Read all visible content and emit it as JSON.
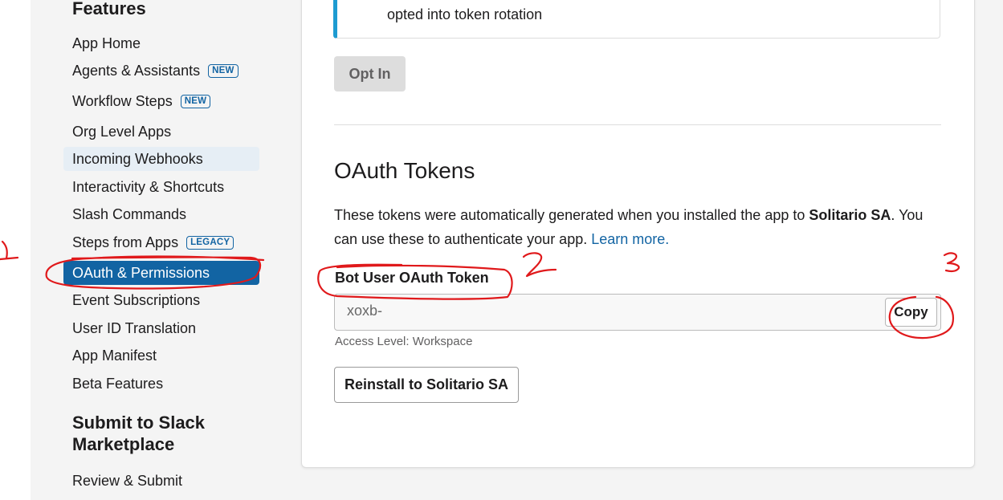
{
  "sidebar": {
    "features_title": "Features",
    "items": [
      {
        "label": "App Home"
      },
      {
        "label": "Agents & Assistants",
        "badge": "NEW"
      },
      {
        "label": "Workflow Steps",
        "badge": "NEW"
      },
      {
        "label": "Org Level Apps"
      },
      {
        "label": "Incoming Webhooks"
      },
      {
        "label": "Interactivity & Shortcuts"
      },
      {
        "label": "Slash Commands"
      },
      {
        "label": "Steps from Apps",
        "badge": "LEGACY"
      },
      {
        "label": "OAuth & Permissions"
      },
      {
        "label": "Event Subscriptions"
      },
      {
        "label": "User ID Translation"
      },
      {
        "label": "App Manifest"
      },
      {
        "label": "Beta Features"
      }
    ],
    "submit_title_line1": "Submit to Slack",
    "submit_title_line2": "Marketplace",
    "submit_item": "Review & Submit"
  },
  "main": {
    "notice_text": "opted into token rotation",
    "opt_in_button": "Opt In",
    "oauth_heading": "OAuth Tokens",
    "description_part1": "These tokens were automatically generated when you installed the app to ",
    "description_workspace": "Solitario SA",
    "description_part2": ". You can use these to authenticate your app. ",
    "learn_more": "Learn more.",
    "token_label": "Bot User OAuth Token",
    "token_value": "xoxb-",
    "copy_button": "Copy",
    "access_level": "Access Level: Workspace",
    "reinstall_button": "Reinstall to Solitario SA"
  },
  "annotations": {
    "mark_1": "1",
    "mark_2": "2",
    "mark_3": "3",
    "color": "#e0191b"
  },
  "colors": {
    "accent": "#1264a3",
    "notice_bar": "#1d9bd1"
  }
}
